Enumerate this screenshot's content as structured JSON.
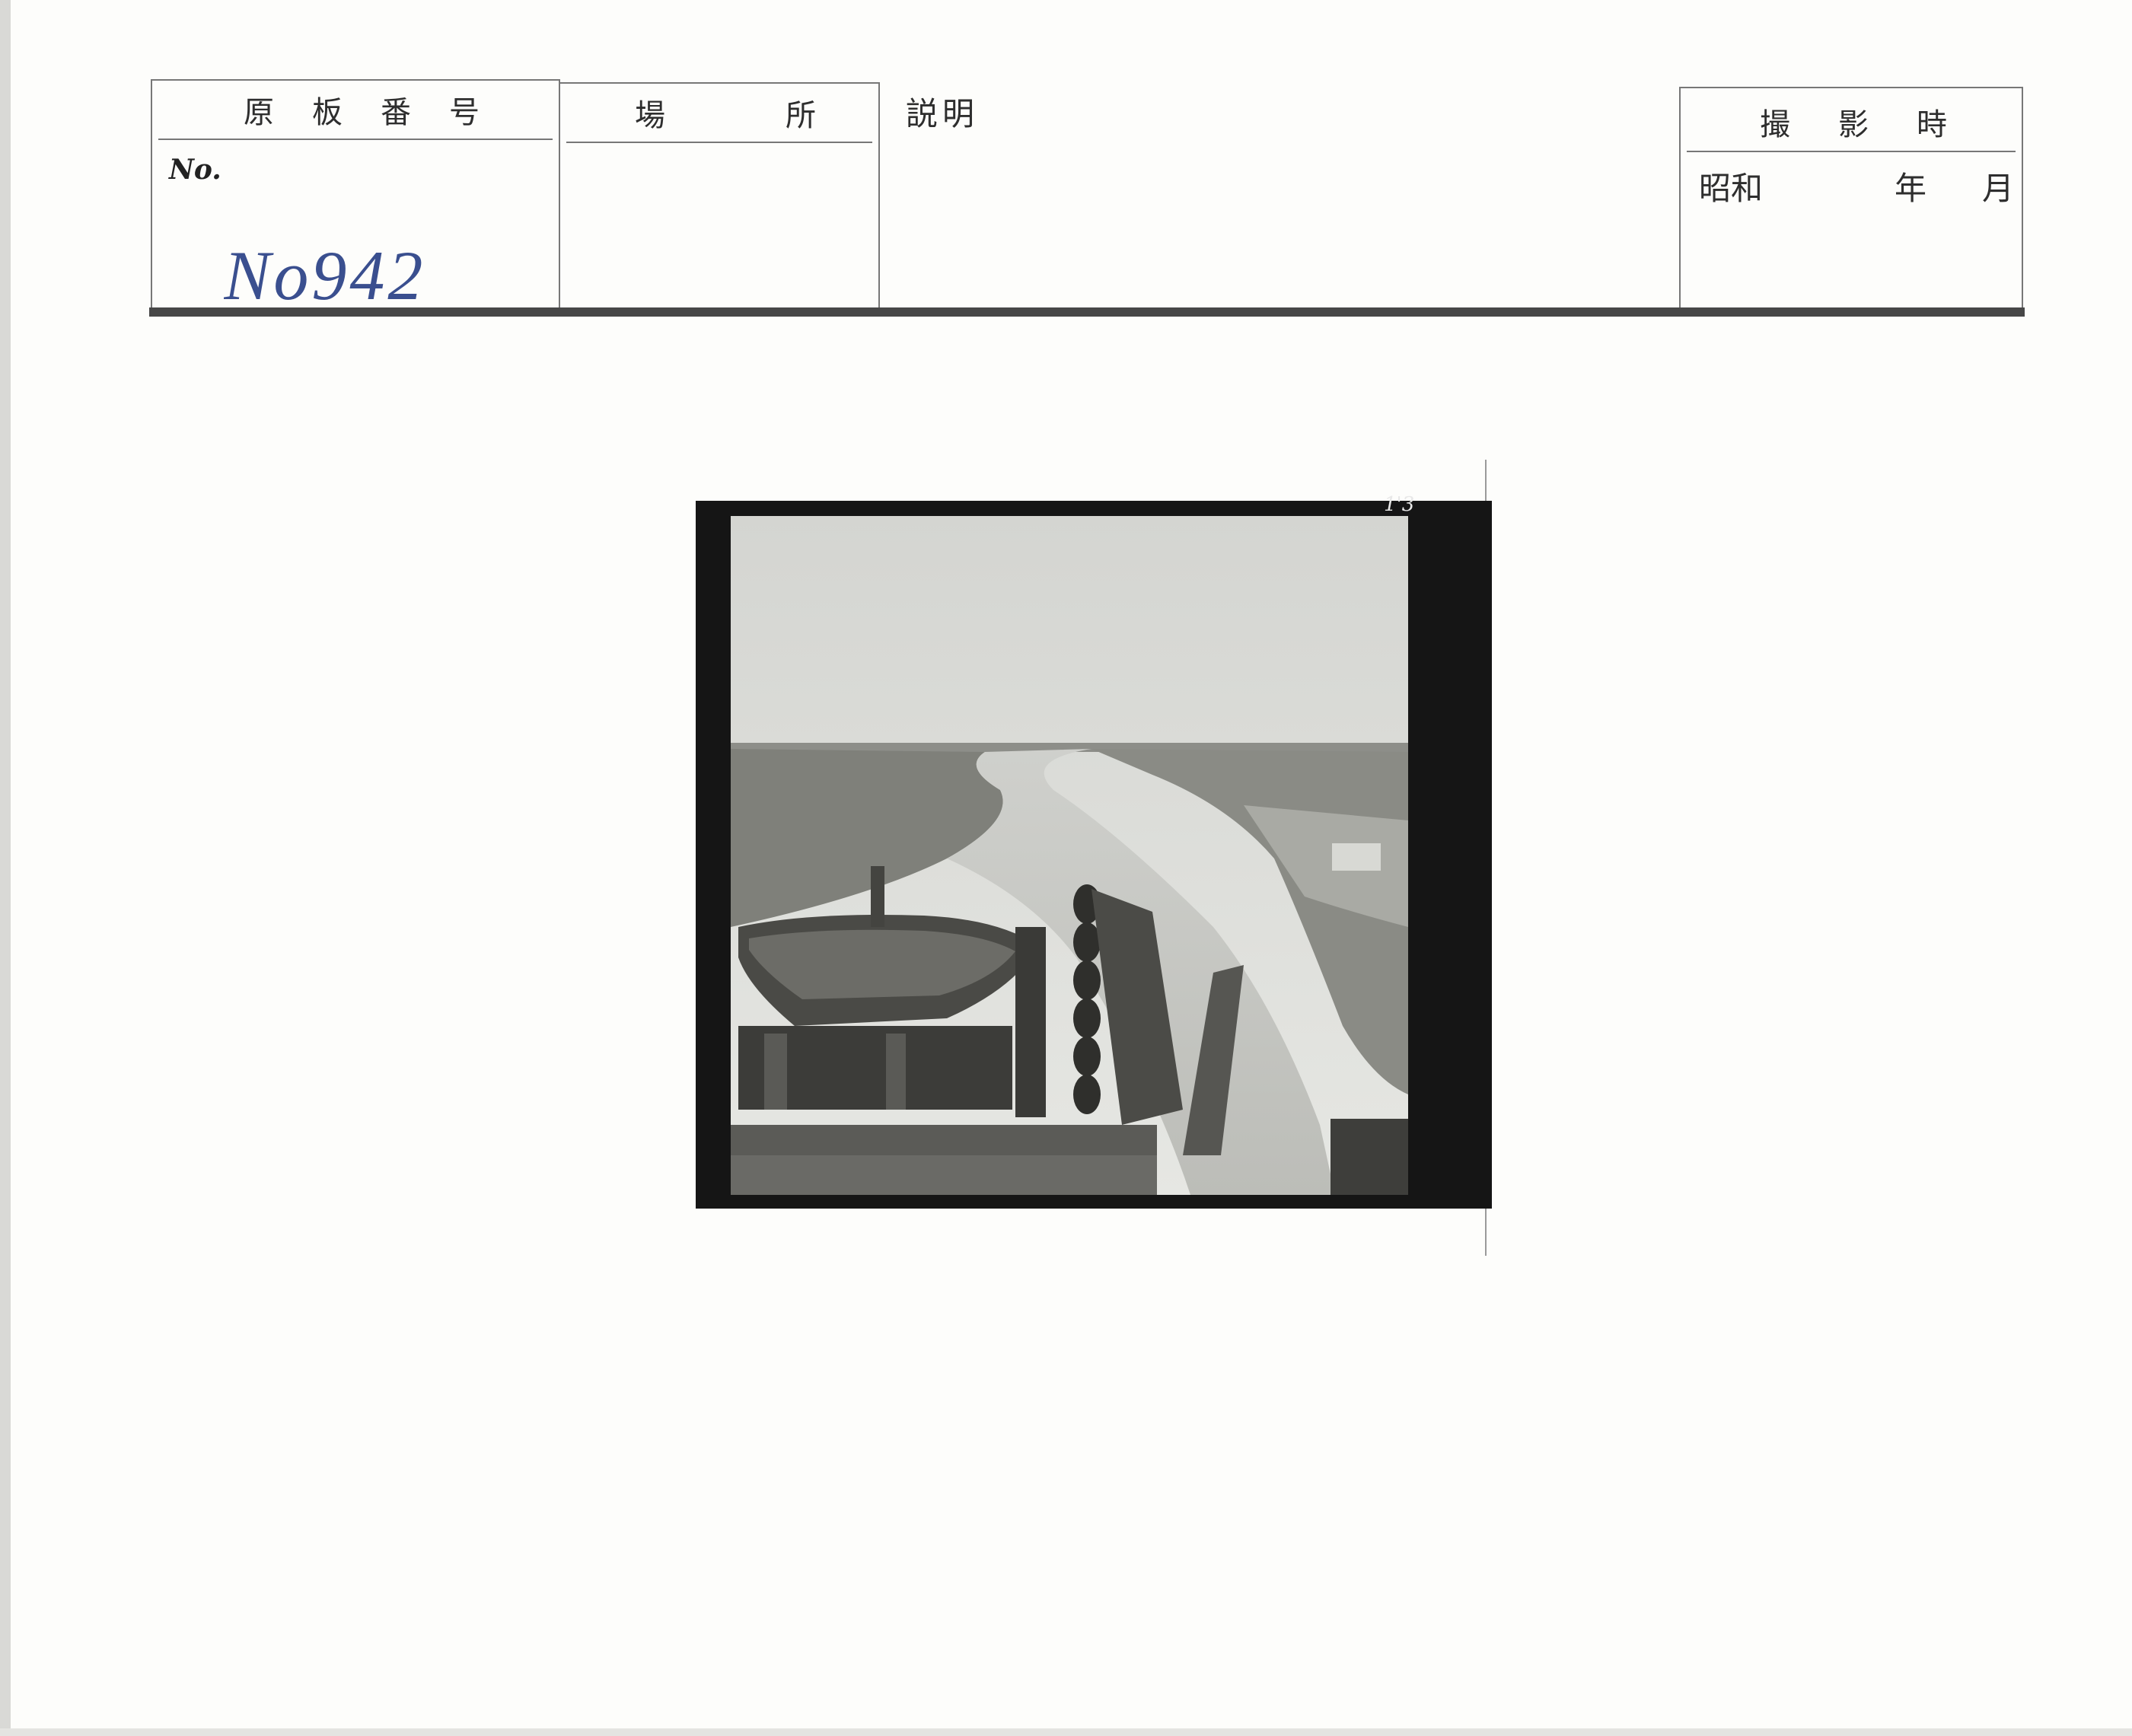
{
  "form": {
    "number_box": {
      "header": [
        "原",
        "板",
        "番",
        "号"
      ],
      "no_label": "No.",
      "handwritten": "No942"
    },
    "place_box": {
      "header": [
        "場",
        "所"
      ]
    },
    "description_label": "説明",
    "date_box": {
      "header": [
        "撮",
        "影",
        "時"
      ],
      "era": "昭和",
      "year_unit": "年",
      "month_unit": "月"
    }
  },
  "photo": {
    "frame_mark": "1'3"
  }
}
